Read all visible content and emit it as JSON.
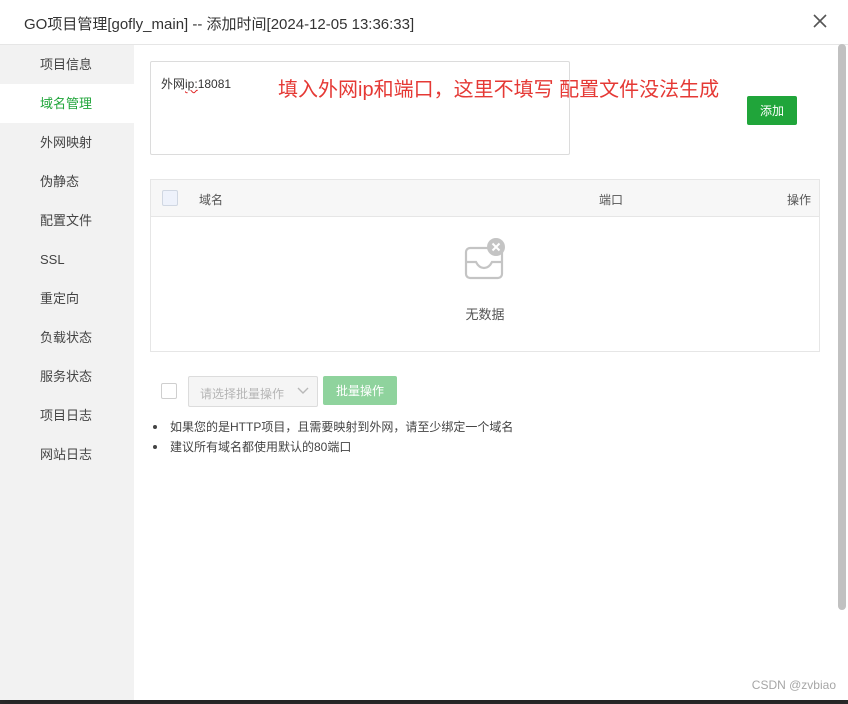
{
  "dialog": {
    "title": "GO项目管理[gofly_main] -- 添加时间[2024-12-05 13:36:33]"
  },
  "sidebar": {
    "items": [
      {
        "label": "项目信息"
      },
      {
        "label": "域名管理",
        "active": true
      },
      {
        "label": "外网映射"
      },
      {
        "label": "伪静态"
      },
      {
        "label": "配置文件"
      },
      {
        "label": "SSL"
      },
      {
        "label": "重定向"
      },
      {
        "label": "负载状态"
      },
      {
        "label": "服务状态"
      },
      {
        "label": "项目日志"
      },
      {
        "label": "网站日志"
      }
    ]
  },
  "domain_input": {
    "prefix": "外网",
    "underlined": "ip:",
    "suffix": "18081"
  },
  "annotation": "填入外网ip和端口，这里不填写 配置文件没法生成",
  "add_button": "添加",
  "table": {
    "columns": [
      "域名",
      "端口",
      "操作"
    ],
    "empty_text": "无数据"
  },
  "batch": {
    "select_placeholder": "请选择批量操作",
    "button": "批量操作"
  },
  "tips": [
    "如果您的是HTTP项目，且需要映射到外网，请至少绑定一个域名",
    "建议所有域名都使用默认的80端口"
  ],
  "watermark": "CSDN @zvbiao",
  "colors": {
    "accent": "#20a53a",
    "annotation": "#e53935"
  }
}
